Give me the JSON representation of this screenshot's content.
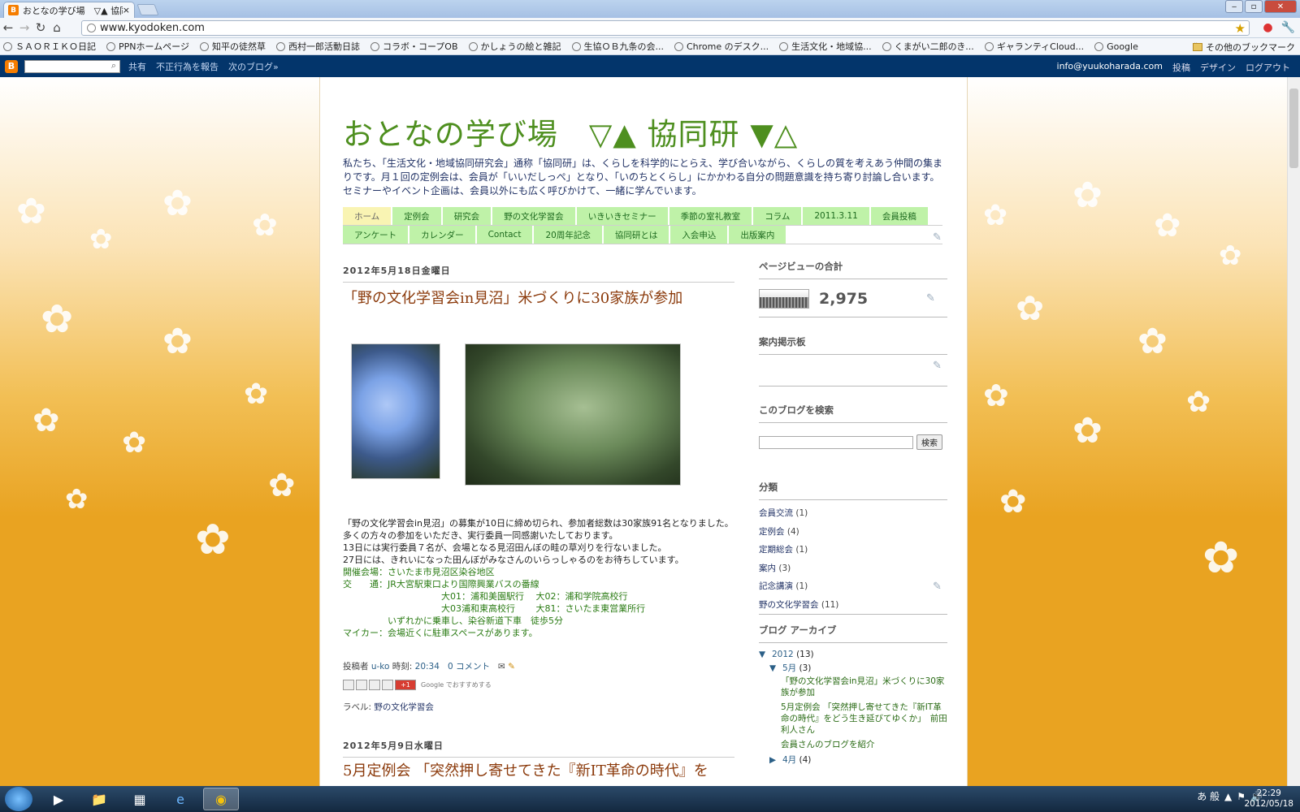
{
  "browser": {
    "tab_title": "おとなの学び場　▽▲ 協同研 ▼△",
    "tab_close": "×",
    "url": "www.kyodoken.com",
    "bookmarks": [
      "ＳＡＯＲＩＫＯ日記",
      "PPNホームページ",
      "知平の徒然草",
      "西村一郎活動日誌",
      "コラボ・コープOB",
      "かしょうの絵と雑記",
      "生協ＯＢ九条の会...",
      "Chrome のデスク...",
      "生活文化・地域協...",
      "くまがい二郎のき...",
      "ギャランティCloud...",
      "Google"
    ],
    "bookmarks_more": "»",
    "other_bookmarks": "その他のブックマーク"
  },
  "blogger_bar": {
    "share": "共有",
    "report": "不正行為を報告",
    "next": "次のブログ»",
    "email": "info@yuukoharada.com",
    "post": "投稿",
    "design": "デザイン",
    "logout": "ログアウト"
  },
  "blog": {
    "title": "おとなの学び場　▽▲ 協同研 ▼△",
    "description": "私たち、「生活文化・地域協同研究会」通称「協同研」は、くらしを科学的にとらえ、学び合いながら、くらしの質を考えあう仲間の集まりです。月１回の定例会は、会員が「いいだしっぺ」となり、「いのちとくらし」にかかわる自分の問題意識を持ち寄り討論し合います。セミナーやイベント企画は、会員以外にも広く呼びかけて、一緒に学んでいます。",
    "tabs_row1": [
      "ホーム",
      "定例会",
      "研究会",
      "野の文化学習会",
      "いきいきセミナー",
      "季節の室礼教室",
      "コラム",
      "2011.3.11",
      "会員投稿"
    ],
    "tabs_row2": [
      "アンケート",
      "カレンダー",
      "Contact",
      "20周年記念",
      "協同研とは",
      "入会申込",
      "出版案内"
    ]
  },
  "post1": {
    "date": "2012年5月18日金曜日",
    "title": "「野の文化学習会in見沼」米づくりに30家族が参加",
    "lines": [
      "「野の文化学習会in見沼」の募集が10日に締め切られ、参加者総数は30家族91名となりました。",
      "多くの方々の参加をいただき、実行委員一同感謝いたしております。",
      "13日には実行委員７名が、会場となる見沼田んぼの畦の草刈りを行ないました。",
      "27日には、きれいになった田んぼがみなさんのいらっしゃるのをお待ちしています。"
    ],
    "green_lines": [
      "開催会場：さいたま市見沼区染谷地区",
      "交　　通：JR大宮駅東口より国際興業バスの番線",
      "　　　　　　　　　　　大01：浦和美園駅行　 大02：浦和学院高校行",
      "　　　　　　　　　　　大03浦和東高校行　　 大81：さいたま東営業所行",
      "　　　　　いずれかに乗車し、染谷新道下車　徒歩5分",
      "マイカー：会場近くに駐車スペースがあります。"
    ],
    "author_prefix": "投稿者",
    "author": "u-ko",
    "time_prefix": "時刻:",
    "time": "20:34",
    "comments": "0 コメント",
    "recommend": "Google でおすすめする",
    "plus_one": "+1",
    "label_prefix": "ラベル:",
    "label": "野の文化学習会"
  },
  "post2": {
    "date": "2012年5月9日水曜日",
    "title": "5月定例会 「突然押し寄せてきた『新IT革命の時代』を"
  },
  "sidebar": {
    "pageviews_title": "ページビューの合計",
    "pageviews": "2,975",
    "board_title": "案内掲示板",
    "search_title": "このブログを検索",
    "search_button": "検索",
    "labels_title": "分類",
    "labels": [
      {
        "name": "会員交流",
        "count": "(1)"
      },
      {
        "name": "定例会",
        "count": "(4)"
      },
      {
        "name": "定期総会",
        "count": "(1)"
      },
      {
        "name": "案内",
        "count": "(3)"
      },
      {
        "name": "記念講演",
        "count": "(1)"
      },
      {
        "name": "野の文化学習会",
        "count": "(11)"
      }
    ],
    "archive_title": "ブログ アーカイブ",
    "archive": {
      "year_tri": "▼",
      "year": "2012",
      "year_count": "(13)",
      "month_tri": "▼",
      "month": "5月",
      "month_count": "(3)",
      "posts": [
        "「野の文化学習会in見沼」米づくりに30家族が参加",
        "5月定例会 「突然押し寄せてきた『新IT革命の時代』をどう生き延びてゆくか」　前田利人さん",
        "会員さんのブログを紹介"
      ],
      "prev_tri": "▶",
      "prev_month": "4月",
      "prev_count": "(4)"
    }
  },
  "taskbar": {
    "ime": "あ 般",
    "time": "22:29",
    "date": "2012/05/18"
  },
  "colors": {
    "title_green": "#4e8f1f",
    "tab_green": "#bff2a8",
    "post_title": "#8b3a0b",
    "blogger_bar": "#03356b"
  }
}
